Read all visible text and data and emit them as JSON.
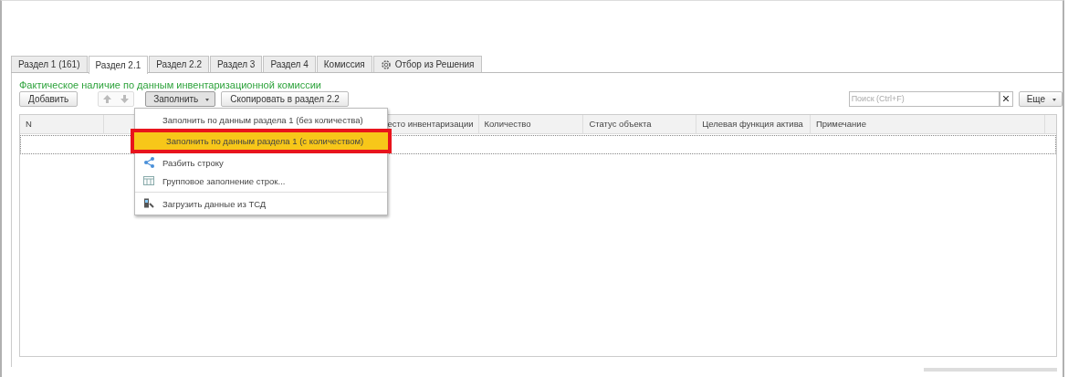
{
  "tabs": [
    {
      "label": "Раздел 1 (161)",
      "selected": false
    },
    {
      "label": "Раздел 2.1",
      "selected": true
    },
    {
      "label": "Раздел 2.2",
      "selected": false
    },
    {
      "label": "Раздел 3",
      "selected": false
    },
    {
      "label": "Раздел 4",
      "selected": false
    },
    {
      "label": "Комиссия",
      "selected": false
    },
    {
      "label": "Отбор из Решения",
      "selected": false,
      "kind": "settings"
    }
  ],
  "section_title": "Фактическое наличие по данным инвентаризационной комиссии",
  "toolbar": {
    "add": "Добавить",
    "fill": "Заполнить",
    "copy": "Скопировать в раздел 2.2",
    "search": {
      "placeholder": "Поиск (Ctrl+F)"
    },
    "more": "Еще"
  },
  "table": {
    "columns": [
      {
        "label": "N"
      },
      {},
      {
        "label": "есто инвентаризации"
      },
      {
        "label": "Количество"
      },
      {
        "label": "Статус объекта"
      },
      {
        "label": "Целевая функция актива"
      },
      {
        "label": "Примечание"
      }
    ]
  },
  "menu": {
    "items": [
      {
        "kind": "item",
        "label": "Заполнить по данным раздела 1 (без количества)",
        "selected": false
      },
      {
        "kind": "item",
        "label": "Заполнить по данным раздела 1 (с количеством)",
        "selected": true
      },
      {
        "kind": "split",
        "label": "Разбить строку",
        "selected": false
      },
      {
        "kind": "grid",
        "label": "Групповое заполнение строк...",
        "selected": false
      },
      {
        "kind": "separator"
      },
      {
        "kind": "scanner",
        "label": "Загрузить данные из ТСД",
        "selected": false
      }
    ]
  }
}
